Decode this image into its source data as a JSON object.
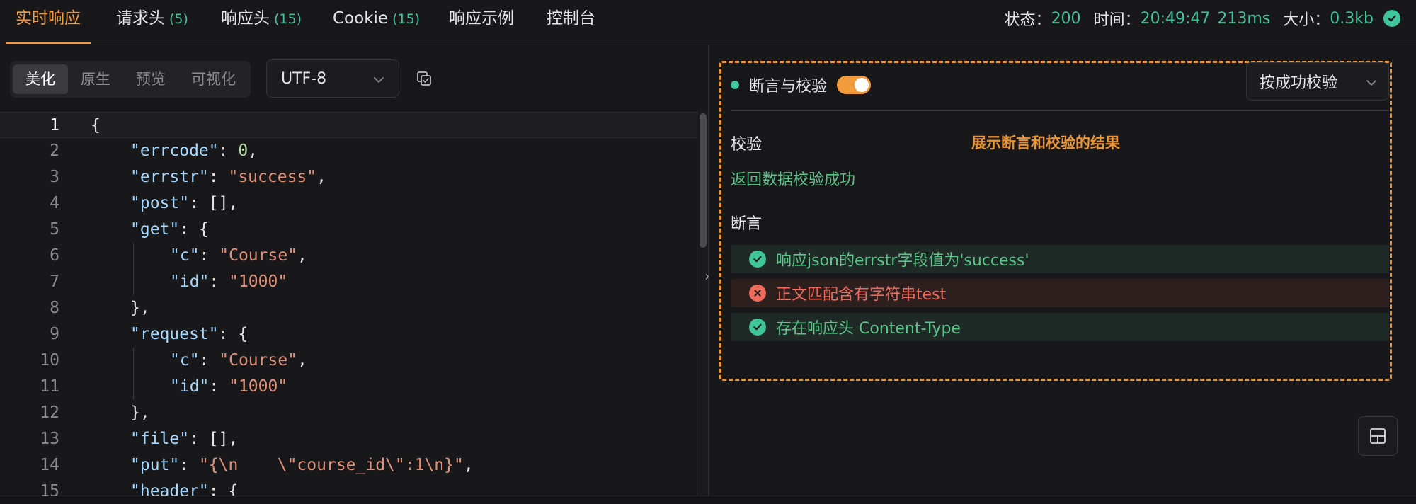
{
  "tabs": [
    {
      "label": "实时响应",
      "count": ""
    },
    {
      "label": "请求头",
      "count": "(5)"
    },
    {
      "label": "响应头",
      "count": "(15)"
    },
    {
      "label": "Cookie",
      "count": "(15)"
    },
    {
      "label": "响应示例",
      "count": ""
    },
    {
      "label": "控制台",
      "count": ""
    }
  ],
  "status": {
    "status_label": "状态：",
    "status_value": "200",
    "time_label": "时间：",
    "time_value": "20:49:47",
    "duration": "213ms",
    "size_label": "大小：",
    "size_value": "0.3kb"
  },
  "view_modes": [
    "美化",
    "原生",
    "预览",
    "可视化"
  ],
  "encoding": "UTF-8",
  "code_lines": [
    {
      "n": "1",
      "indent": 0,
      "parts": [
        [
          "p",
          "{"
        ]
      ]
    },
    {
      "n": "2",
      "indent": 1,
      "parts": [
        [
          "k",
          "\"errcode\""
        ],
        [
          "p",
          ": "
        ],
        [
          "n",
          "0"
        ],
        [
          "p",
          ","
        ]
      ]
    },
    {
      "n": "3",
      "indent": 1,
      "parts": [
        [
          "k",
          "\"errstr\""
        ],
        [
          "p",
          ": "
        ],
        [
          "s",
          "\"success\""
        ],
        [
          "p",
          ","
        ]
      ]
    },
    {
      "n": "4",
      "indent": 1,
      "parts": [
        [
          "k",
          "\"post\""
        ],
        [
          "p",
          ": [],"
        ]
      ]
    },
    {
      "n": "5",
      "indent": 1,
      "parts": [
        [
          "k",
          "\"get\""
        ],
        [
          "p",
          ": {"
        ]
      ]
    },
    {
      "n": "6",
      "indent": 2,
      "parts": [
        [
          "k",
          "\"c\""
        ],
        [
          "p",
          ": "
        ],
        [
          "s",
          "\"Course\""
        ],
        [
          "p",
          ","
        ]
      ]
    },
    {
      "n": "7",
      "indent": 2,
      "parts": [
        [
          "k",
          "\"id\""
        ],
        [
          "p",
          ": "
        ],
        [
          "s",
          "\"1000\""
        ]
      ]
    },
    {
      "n": "8",
      "indent": 1,
      "parts": [
        [
          "p",
          "},"
        ]
      ]
    },
    {
      "n": "9",
      "indent": 1,
      "parts": [
        [
          "k",
          "\"request\""
        ],
        [
          "p",
          ": {"
        ]
      ]
    },
    {
      "n": "10",
      "indent": 2,
      "parts": [
        [
          "k",
          "\"c\""
        ],
        [
          "p",
          ": "
        ],
        [
          "s",
          "\"Course\""
        ],
        [
          "p",
          ","
        ]
      ]
    },
    {
      "n": "11",
      "indent": 2,
      "parts": [
        [
          "k",
          "\"id\""
        ],
        [
          "p",
          ": "
        ],
        [
          "s",
          "\"1000\""
        ]
      ]
    },
    {
      "n": "12",
      "indent": 1,
      "parts": [
        [
          "p",
          "},"
        ]
      ]
    },
    {
      "n": "13",
      "indent": 1,
      "parts": [
        [
          "k",
          "\"file\""
        ],
        [
          "p",
          ": [],"
        ]
      ]
    },
    {
      "n": "14",
      "indent": 1,
      "parts": [
        [
          "k",
          "\"put\""
        ],
        [
          "p",
          ": "
        ],
        [
          "s",
          "\"{\\n    \\\"course_id\\\":1\\n}\""
        ],
        [
          "p",
          ","
        ]
      ]
    },
    {
      "n": "15",
      "indent": 1,
      "parts": [
        [
          "k",
          "\"header\""
        ],
        [
          "p",
          ": {"
        ]
      ]
    }
  ],
  "assertions": {
    "title": "断言与校验",
    "enabled": true,
    "mode": "按成功校验",
    "annotation": "展示断言和校验的结果",
    "verify_label": "校验",
    "verify_result": "返回数据校验成功",
    "assert_label": "断言",
    "results": [
      {
        "text": "响应json的errstr字段值为'success'",
        "status": "pass"
      },
      {
        "text": "正文匹配含有字符串test",
        "status": "fail"
      },
      {
        "text": "存在响应头 Content-Type",
        "status": "pass"
      }
    ]
  },
  "colors": {
    "accent": "#f29b3c",
    "success": "#40c49a",
    "error": "#ee6a5c",
    "annotation": "#e89536"
  },
  "icons": {
    "status_ok": "check-circle-icon",
    "copy": "copy-icon",
    "dropdown": "chevron-down-icon",
    "layout": "layout-icon",
    "collapse": "chevron-right-icon"
  }
}
